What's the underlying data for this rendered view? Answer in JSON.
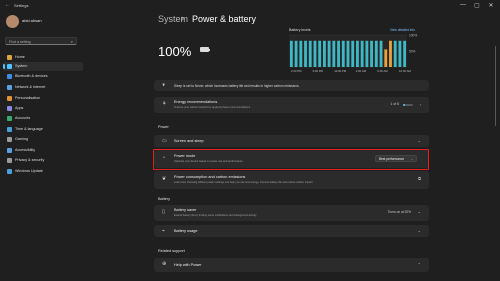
{
  "window": {
    "title": "Settings",
    "controls": [
      "—",
      "▢",
      "✕"
    ]
  },
  "user": {
    "name": "abid ahsan"
  },
  "search": {
    "placeholder": "Find a setting",
    "icon": "search-icon"
  },
  "sidebar": {
    "items": [
      {
        "label": "Home",
        "icon": "home-icon",
        "color": "#d9a441"
      },
      {
        "label": "System",
        "icon": "system-icon",
        "color": "#4cc2ff",
        "active": true
      },
      {
        "label": "Bluetooth & devices",
        "icon": "bluetooth-icon",
        "color": "#3a8ee6"
      },
      {
        "label": "Network & internet",
        "icon": "network-icon",
        "color": "#5aa0e0"
      },
      {
        "label": "Personalisation",
        "icon": "brush-icon",
        "color": "#e0913a"
      },
      {
        "label": "Apps",
        "icon": "apps-icon",
        "color": "#8a8ae0"
      },
      {
        "label": "Accounts",
        "icon": "account-icon",
        "color": "#3aa870"
      },
      {
        "label": "Time & language",
        "icon": "clock-icon",
        "color": "#4aa0d8"
      },
      {
        "label": "Gaming",
        "icon": "gaming-icon",
        "color": "#9a9a9a"
      },
      {
        "label": "Accessibility",
        "icon": "accessibility-icon",
        "color": "#5aa0e0"
      },
      {
        "label": "Privacy & security",
        "icon": "shield-icon",
        "color": "#9a9a9a"
      },
      {
        "label": "Windows Update",
        "icon": "update-icon",
        "color": "#4aa0d8"
      }
    ]
  },
  "breadcrumb": {
    "parent": "System",
    "separator": "›",
    "current": "Power & battery"
  },
  "battery": {
    "percent": "100%",
    "level": 1.0
  },
  "chart_data": {
    "type": "bar",
    "title": "Battery levels",
    "link": "View detailed info",
    "ytick_labels": [
      "100%",
      "50%"
    ],
    "xtick_labels": [
      "2:00 PM",
      "6:00 PM",
      "10:00 PM",
      "2:00 AM",
      "6:00 AM",
      "10:00 AM"
    ],
    "values": [
      82,
      82,
      82,
      82,
      82,
      82,
      82,
      82,
      82,
      82,
      82,
      82,
      82,
      82,
      82,
      82,
      82,
      82,
      82,
      82,
      55,
      82,
      82,
      82,
      82
    ],
    "highlight_indices": [
      20,
      21
    ],
    "colors": {
      "normal": "#3fb8c6",
      "highlight": "#e8a33a",
      "background": "#262626"
    }
  },
  "notice": {
    "text": "Sleep is set to Never, which increases battery life and results in higher carbon emissions."
  },
  "energy": {
    "title": "Energy recommendations",
    "subtitle": "Improve your carbon footprint by applying these recommendations",
    "status": "1 of 6"
  },
  "power_section": {
    "heading": "Power",
    "screen_sleep": {
      "title": "Screen and sleep"
    },
    "power_mode": {
      "title": "Power mode",
      "subtitle": "Optimise your device based on power use and performance",
      "value": "Best performance"
    },
    "consumption": {
      "title": "Power consumption and carbon emissions",
      "subtitle": "Learn how choosing efficient power settings can help you use less energy, improve battery life and reduce carbon impact"
    }
  },
  "battery_section": {
    "heading": "Battery",
    "saver": {
      "title": "Battery saver",
      "subtitle": "Extend battery life by limiting some notifications and background activity",
      "status": "Turns on at 20%"
    },
    "usage": {
      "title": "Battery usage"
    }
  },
  "related": {
    "heading": "Related support",
    "help": {
      "title": "Help with Power"
    }
  }
}
